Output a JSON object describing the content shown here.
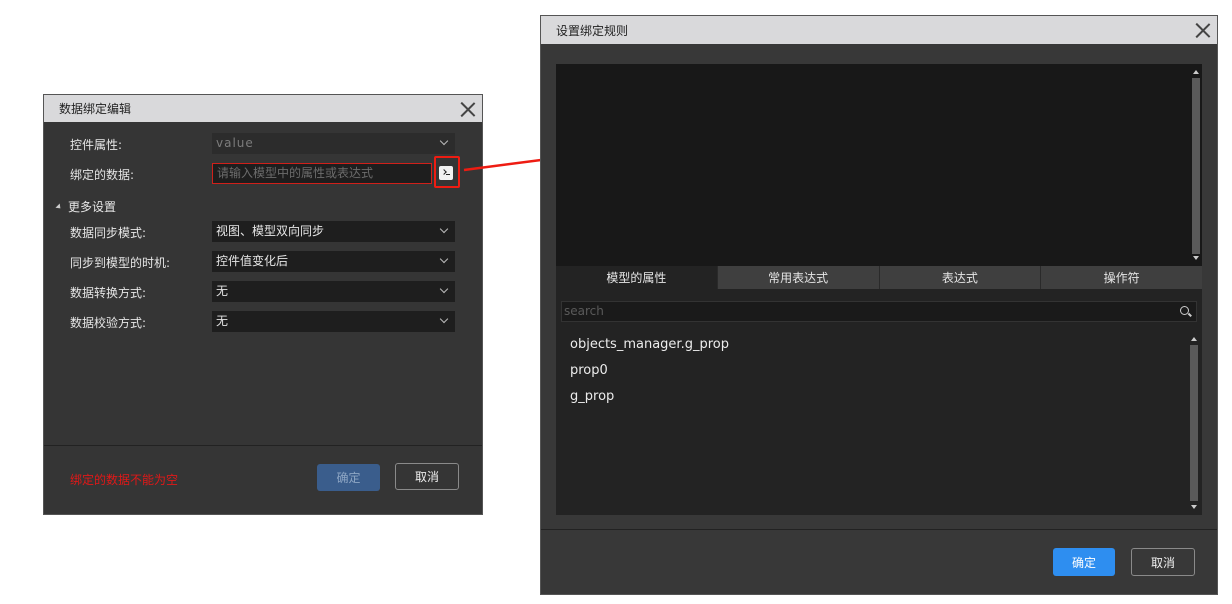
{
  "left_dialog": {
    "title": "数据绑定编辑",
    "fields": [
      {
        "label": "控件属性:",
        "value": "value",
        "disabled": true
      },
      {
        "label": "绑定的数据:",
        "placeholder": "请输入模型中的属性或表达式",
        "value": ""
      }
    ],
    "more_settings_label": "更多设置",
    "settings": [
      {
        "label": "数据同步模式:",
        "value": "视图、模型双向同步"
      },
      {
        "label": "同步到模型的时机:",
        "value": "控件值变化后"
      },
      {
        "label": "数据转换方式:",
        "value": "无"
      },
      {
        "label": "数据校验方式:",
        "value": "无"
      }
    ],
    "error_message": "绑定的数据不能为空",
    "ok_label": "确定",
    "cancel_label": "取消"
  },
  "right_dialog": {
    "title": "设置绑定规则",
    "expression_text": "",
    "tabs": [
      {
        "label": "模型的属性",
        "active": true
      },
      {
        "label": "常用表达式",
        "active": false
      },
      {
        "label": "表达式",
        "active": false
      },
      {
        "label": "操作符",
        "active": false
      }
    ],
    "search": {
      "placeholder": "search",
      "value": ""
    },
    "properties": [
      "objects_manager.g_prop",
      "prop0",
      "g_prop"
    ],
    "ok_label": "确定",
    "cancel_label": "取消"
  },
  "colors": {
    "highlight": "#ee1c12",
    "primary": "#2e8ef0",
    "error_text": "#e01818"
  }
}
